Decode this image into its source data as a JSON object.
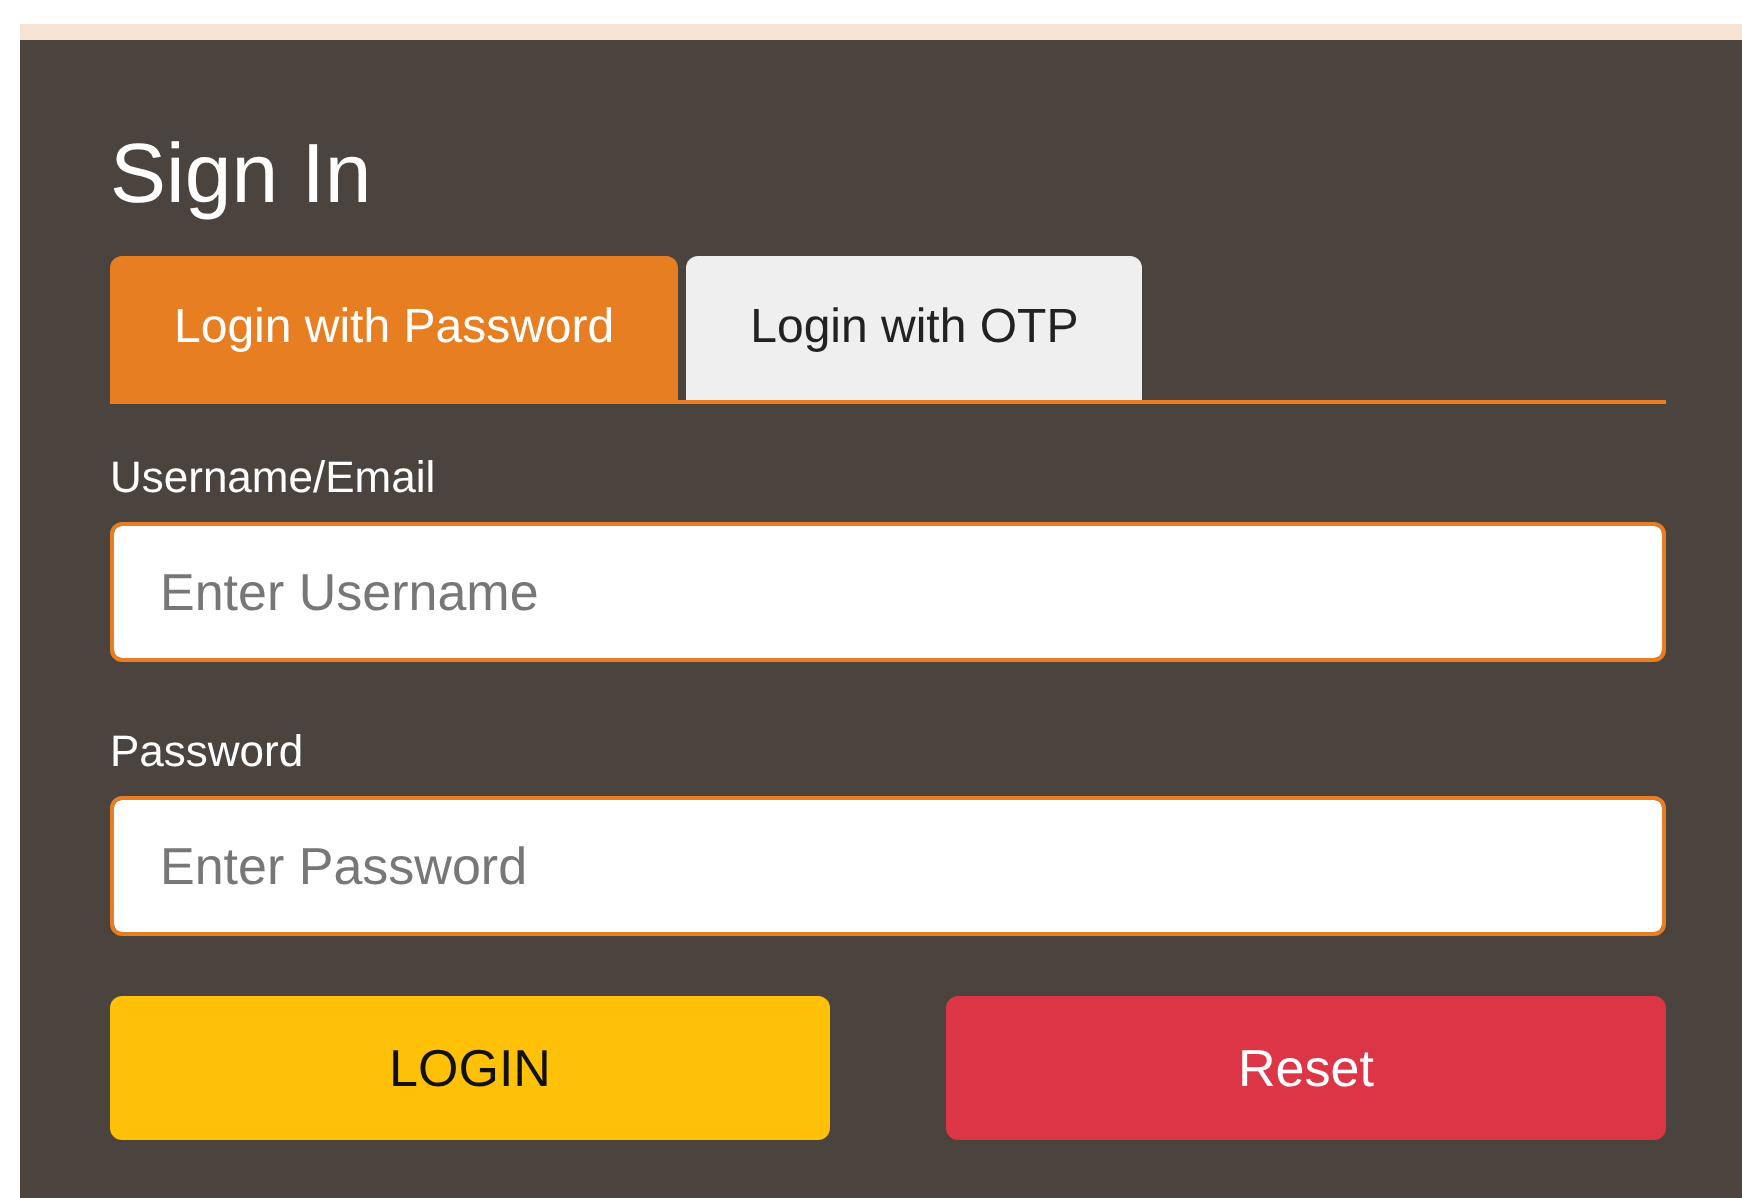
{
  "title": "Sign In",
  "tabs": [
    {
      "label": "Login with Password",
      "selected": true
    },
    {
      "label": "Login with OTP",
      "selected": false
    }
  ],
  "fields": [
    {
      "label": "Username/Email",
      "placeholder": "Enter Username"
    },
    {
      "label": "Password",
      "placeholder": "Enter Password"
    }
  ],
  "buttons": [
    {
      "label": "LOGIN",
      "kind": "submit"
    },
    {
      "label": "Reset",
      "kind": "reset"
    }
  ]
}
